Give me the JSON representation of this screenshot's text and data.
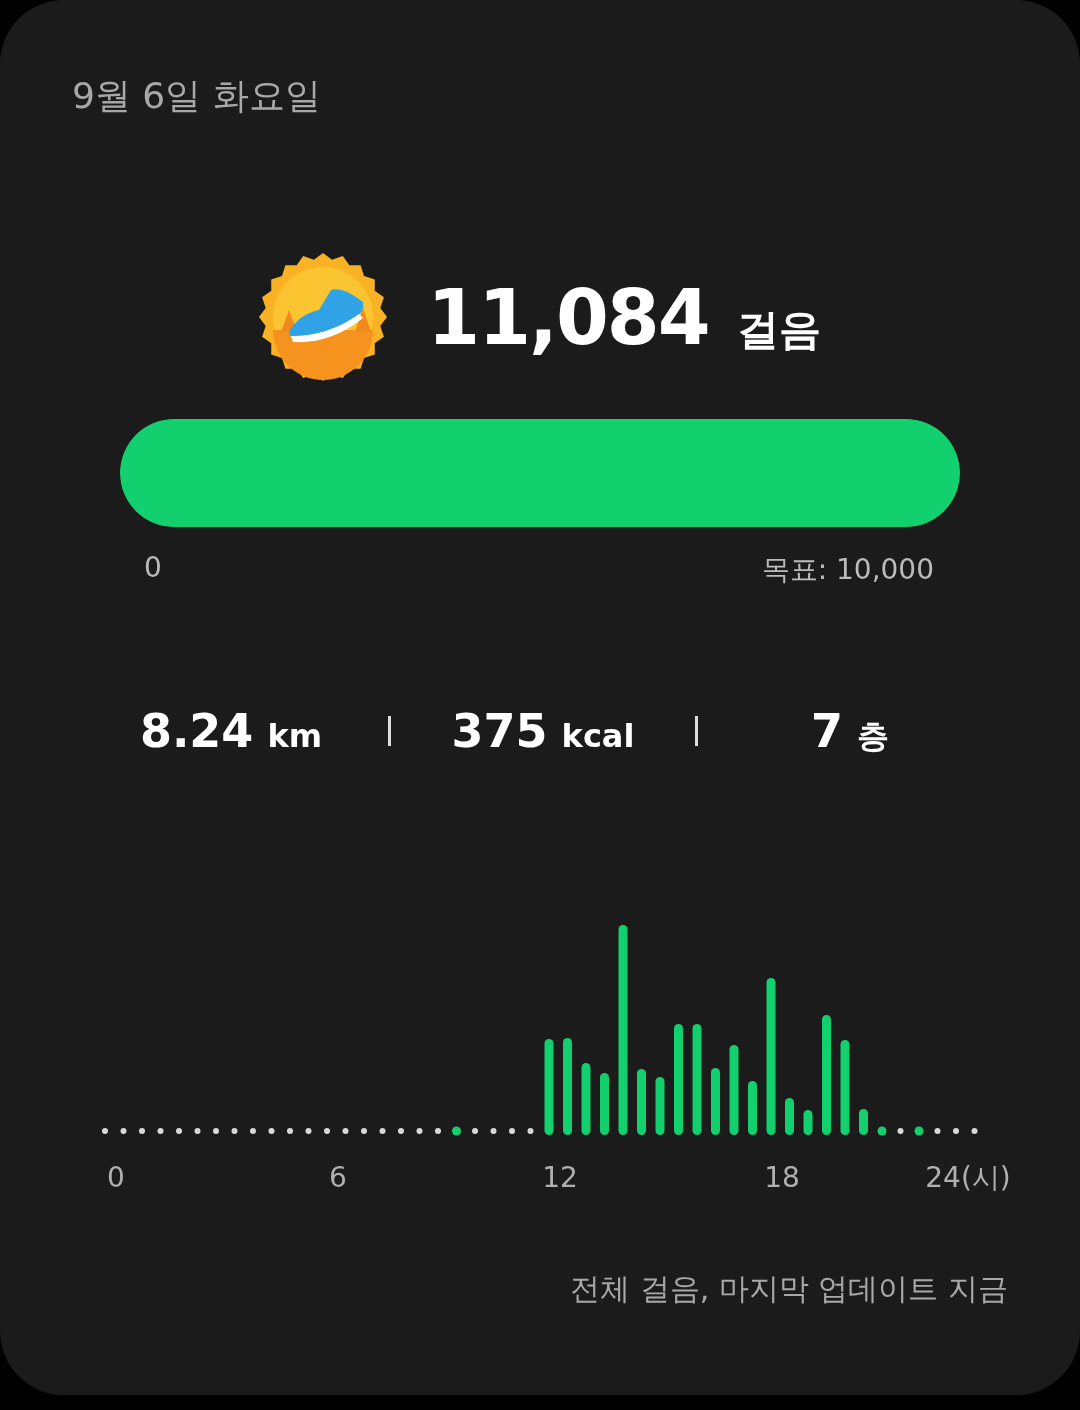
{
  "date": "9월 6일 화요일",
  "steps": {
    "count": "11,084",
    "unit": "걸음"
  },
  "progress": {
    "level": 1,
    "start_label": "0",
    "goal_label": "목표: 10,000"
  },
  "stats": [
    {
      "value": "8.24",
      "unit": "km"
    },
    {
      "value": "375",
      "unit": "kcal"
    },
    {
      "value": "7",
      "unit": "층"
    }
  ],
  "hourly_chart": {
    "kind": "picture",
    "x_labels": [
      "0",
      "6",
      "12",
      "18",
      "24(시)"
    ]
  },
  "footer": "전체 걸음, 마지막 업데이트 지금"
}
